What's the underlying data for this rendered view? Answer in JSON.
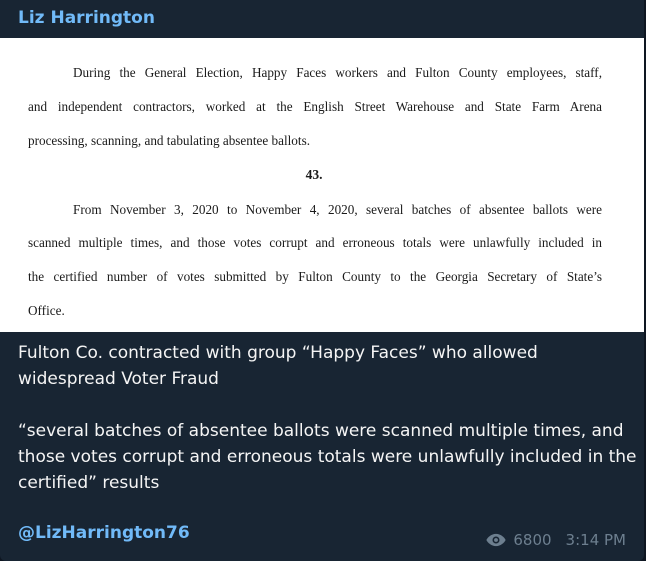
{
  "post": {
    "author": "Liz Harrington",
    "document": {
      "paragraph1": [
        "During the General Election, Happy Faces workers and Fulton County employees, staff,",
        "and independent contractors, worked at the English Street Warehouse and State Farm Arena",
        "processing, scanning, and tabulating absentee ballots."
      ],
      "section_number": "43.",
      "paragraph2": [
        "From November 3, 2020 to November 4, 2020, several batches of absentee ballots were",
        "scanned multiple times, and those votes corrupt and erroneous totals were unlawfully included in",
        "the certified number of votes submitted by Fulton County to the Georgia Secretary of State’s",
        "Office."
      ]
    },
    "message": {
      "line1": "Fulton Co. contracted with group “Happy Faces” who allowed widespread Voter Fraud",
      "line2": "“several batches of absentee ballots were scanned multiple times, and those votes corrupt and erroneous totals were unlawfully included in the certified” results"
    },
    "handle": "@LizHarrington76",
    "views": "6800",
    "time": "3:14 PM",
    "icons": {
      "views": "eye-icon"
    },
    "colors": {
      "accent": "#71baf8",
      "background": "#182533",
      "meta": "#6d7f8f"
    }
  }
}
